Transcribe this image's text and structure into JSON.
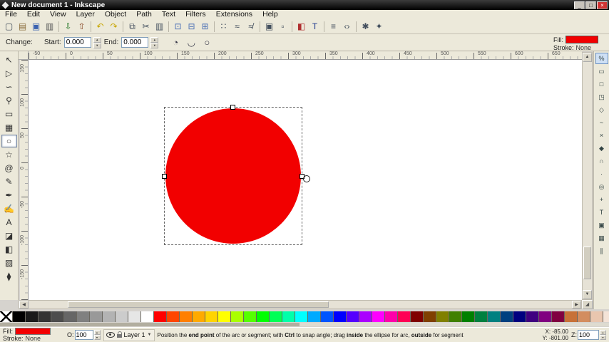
{
  "window": {
    "title": "New document 1 - Inkscape",
    "controls": {
      "minimize_glyph": "_",
      "maximize_glyph": "□",
      "close_glyph": "×"
    }
  },
  "menubar": {
    "items": [
      "File",
      "Edit",
      "View",
      "Layer",
      "Object",
      "Path",
      "Text",
      "Filters",
      "Extensions",
      "Help"
    ]
  },
  "command_toolbar": {
    "buttons": [
      {
        "name": "new-document",
        "glyph": "▢"
      },
      {
        "name": "open-document",
        "glyph": "▤",
        "color": "#8a6d3b"
      },
      {
        "name": "save-document",
        "glyph": "▣",
        "color": "#3a62b0"
      },
      {
        "name": "print-document",
        "glyph": "▥",
        "color": "#555555"
      },
      {
        "sep": true
      },
      {
        "name": "import",
        "glyph": "⇩",
        "color": "#2f7d31"
      },
      {
        "name": "export",
        "glyph": "⇧",
        "color": "#8a4b2a"
      },
      {
        "sep": true
      },
      {
        "name": "undo",
        "glyph": "↶",
        "color": "#c7a500"
      },
      {
        "name": "redo",
        "glyph": "↷",
        "color": "#c7a500"
      },
      {
        "sep": true
      },
      {
        "name": "copy",
        "glyph": "⧉"
      },
      {
        "name": "cut",
        "glyph": "✂"
      },
      {
        "name": "paste",
        "glyph": "▥"
      },
      {
        "sep": true
      },
      {
        "name": "zoom-to-selection",
        "glyph": "⊡",
        "color": "#4a6fb5"
      },
      {
        "name": "zoom-to-drawing",
        "glyph": "⊟",
        "color": "#4a6fb5"
      },
      {
        "name": "zoom-to-page",
        "glyph": "⊞",
        "color": "#4a6fb5"
      },
      {
        "sep": true
      },
      {
        "name": "duplicate",
        "glyph": "∷"
      },
      {
        "name": "create-clone",
        "glyph": "≈"
      },
      {
        "name": "unlink-clone",
        "glyph": "≉"
      },
      {
        "sep": true
      },
      {
        "name": "group",
        "glyph": "▣"
      },
      {
        "name": "ungroup",
        "glyph": "▫"
      },
      {
        "sep": true
      },
      {
        "name": "fill-stroke-dialog",
        "glyph": "◧",
        "color": "#b03030"
      },
      {
        "name": "text-dialog",
        "glyph": "T",
        "color": "#203a8f"
      },
      {
        "sep": true
      },
      {
        "name": "align-dialog",
        "glyph": "≡"
      },
      {
        "name": "xml-editor",
        "glyph": "‹›"
      },
      {
        "sep": true
      },
      {
        "name": "document-properties",
        "glyph": "✱"
      },
      {
        "name": "preferences",
        "glyph": "✦"
      }
    ]
  },
  "tool_options": {
    "change_label": "Change:",
    "start_label": "Start:",
    "start_value": "0.000",
    "end_label": "End:",
    "end_value": "0.000",
    "buttons": [
      {
        "name": "arc-slice",
        "glyph": "◔"
      },
      {
        "name": "arc-open",
        "glyph": "◡"
      },
      {
        "name": "make-whole",
        "glyph": "○"
      }
    ]
  },
  "fill_stroke_indicator": {
    "fill_label": "Fill:",
    "fill_color": "#f20000",
    "stroke_label": "Stroke:",
    "stroke_value": "None"
  },
  "toolbox": {
    "tools": [
      {
        "name": "selector",
        "glyph": "↖"
      },
      {
        "name": "node-editor",
        "glyph": "▷"
      },
      {
        "name": "tweak",
        "glyph": "∽"
      },
      {
        "name": "zoom",
        "glyph": "⚲"
      },
      {
        "name": "rectangle",
        "glyph": "▭"
      },
      {
        "name": "3dbox",
        "glyph": "▦"
      },
      {
        "name": "ellipse",
        "glyph": "○",
        "selected": true
      },
      {
        "name": "star",
        "glyph": "☆"
      },
      {
        "name": "spiral",
        "glyph": "@"
      },
      {
        "name": "pencil",
        "glyph": "✎"
      },
      {
        "name": "pen",
        "glyph": "✒"
      },
      {
        "name": "calligraphy",
        "glyph": "✍"
      },
      {
        "name": "text",
        "glyph": "A"
      },
      {
        "name": "eraser",
        "glyph": "◪"
      },
      {
        "name": "paint-bucket",
        "glyph": "◧"
      },
      {
        "name": "gradient",
        "glyph": "▨"
      },
      {
        "name": "dropper",
        "glyph": "⧫"
      }
    ]
  },
  "rulers": {
    "horizontal_labels": [
      "-50",
      "0",
      "50",
      "100",
      "150",
      "200",
      "250",
      "300",
      "350",
      "400",
      "450",
      "500",
      "550",
      "600",
      "650"
    ],
    "vertical_labels": [
      "150",
      "100",
      "50",
      "0",
      "-50",
      "-100",
      "-150"
    ]
  },
  "canvas": {
    "shape": {
      "type": "ellipse",
      "fill": "#f20000"
    }
  },
  "snap_toolbar": {
    "buttons": [
      {
        "name": "snap-enable",
        "glyph": "%",
        "selected": true
      },
      {
        "name": "snap-bbox",
        "glyph": "▭"
      },
      {
        "name": "snap-bbox-edges",
        "glyph": "□"
      },
      {
        "name": "snap-bbox-corners",
        "glyph": "◳"
      },
      {
        "name": "snap-nodes",
        "glyph": "◇"
      },
      {
        "name": "snap-paths",
        "glyph": "~"
      },
      {
        "name": "snap-path-intersections",
        "glyph": "×"
      },
      {
        "name": "snap-cusp-nodes",
        "glyph": "◆"
      },
      {
        "name": "snap-smooth-nodes",
        "glyph": "∩"
      },
      {
        "name": "snap-midpoints",
        "glyph": "∙"
      },
      {
        "name": "snap-object-centers",
        "glyph": "◎"
      },
      {
        "name": "snap-rotation-centers",
        "glyph": "+"
      },
      {
        "name": "snap-text-baselines",
        "glyph": "T"
      },
      {
        "name": "snap-page-border",
        "glyph": "▣"
      },
      {
        "name": "snap-grids",
        "glyph": "▦"
      },
      {
        "name": "snap-guides",
        "glyph": "∥"
      }
    ]
  },
  "palette": {
    "none_label": "X",
    "colors": [
      "#000000",
      "#1a1a1a",
      "#333333",
      "#4d4d4d",
      "#666666",
      "#808080",
      "#999999",
      "#b3b3b3",
      "#cccccc",
      "#e6e6e6",
      "#ffffff",
      "#ff0000",
      "#ff4500",
      "#ff7f00",
      "#ffaa00",
      "#ffd400",
      "#ffff00",
      "#aaff00",
      "#55ff00",
      "#00ff00",
      "#00ff55",
      "#00ffaa",
      "#00ffff",
      "#00aaff",
      "#0055ff",
      "#0000ff",
      "#5500ff",
      "#aa00ff",
      "#ff00ff",
      "#ff00aa",
      "#ff0055",
      "#800000",
      "#804000",
      "#808000",
      "#408000",
      "#008000",
      "#008040",
      "#008080",
      "#004080",
      "#000080",
      "#400080",
      "#800080",
      "#800040",
      "#c87137",
      "#d38d5f",
      "#e9c6af",
      "#f4e3d7"
    ]
  },
  "statusbar": {
    "fill_label": "Fill:",
    "fill_color": "#f20000",
    "stroke_label": "Stroke:",
    "stroke_value": "None",
    "opacity_label": "O:",
    "opacity_value": "100",
    "layer_label": "Layer 1",
    "message_segments": [
      {
        "text": "Position the ",
        "bold": false
      },
      {
        "text": "end point",
        "bold": true
      },
      {
        "text": " of the arc or segment; with ",
        "bold": false
      },
      {
        "text": "Ctrl",
        "bold": true
      },
      {
        "text": " to snap angle; drag ",
        "bold": false
      },
      {
        "text": "inside",
        "bold": true
      },
      {
        "text": " the ellipse for arc, ",
        "bold": false
      },
      {
        "text": "outside",
        "bold": true
      },
      {
        "text": " for segment",
        "bold": false
      }
    ],
    "x_label": "X:",
    "x_value": "-85.00",
    "y_label": "Y:",
    "y_value": "-801.00",
    "zoom_label": "Z:",
    "zoom_value": "100"
  },
  "ui": {
    "spin_up": "▲",
    "spin_down": "▼",
    "dropdown_arrow": "▼",
    "scroll_up": "▲",
    "scroll_down": "▼",
    "scroll_left": "◀",
    "scroll_right": "▶",
    "resize_grip": "◢"
  }
}
